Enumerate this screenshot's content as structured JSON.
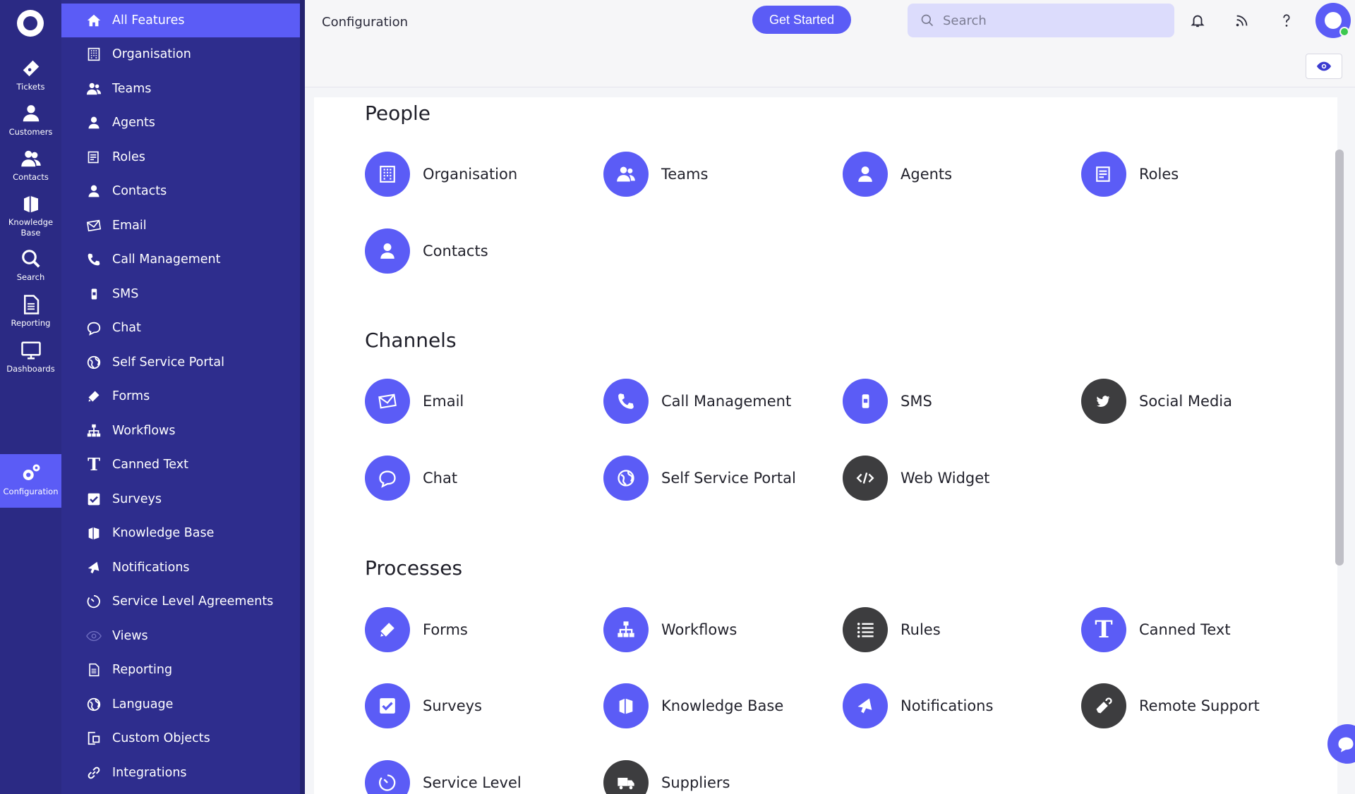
{
  "rail": {
    "items": [
      {
        "label": "Tickets",
        "icon": "ticket-icon"
      },
      {
        "label": "Customers",
        "icon": "customer-icon"
      },
      {
        "label": "Contacts",
        "icon": "contacts-icon"
      },
      {
        "label": "Knowledge Base",
        "icon": "book-icon"
      },
      {
        "label": "Search",
        "icon": "search-icon"
      },
      {
        "label": "Reporting",
        "icon": "report-icon"
      },
      {
        "label": "Dashboards",
        "icon": "monitor-icon"
      },
      {
        "label": "Configuration",
        "icon": "gears-icon"
      }
    ]
  },
  "sidebar": {
    "items": [
      {
        "label": "All Features",
        "icon": "home-icon"
      },
      {
        "label": "Organisation",
        "icon": "building-icon"
      },
      {
        "label": "Teams",
        "icon": "team-icon"
      },
      {
        "label": "Agents",
        "icon": "agent-icon"
      },
      {
        "label": "Roles",
        "icon": "roles-icon"
      },
      {
        "label": "Contacts",
        "icon": "contact-icon"
      },
      {
        "label": "Email",
        "icon": "email-icon"
      },
      {
        "label": "Call Management",
        "icon": "phone-icon"
      },
      {
        "label": "SMS",
        "icon": "mobile-icon"
      },
      {
        "label": "Chat",
        "icon": "chat-icon"
      },
      {
        "label": "Self Service Portal",
        "icon": "globe-icon"
      },
      {
        "label": "Forms",
        "icon": "form-icon"
      },
      {
        "label": "Workflows",
        "icon": "workflow-icon"
      },
      {
        "label": "Canned Text",
        "icon": "text-icon"
      },
      {
        "label": "Surveys",
        "icon": "checkbox-icon"
      },
      {
        "label": "Knowledge Base",
        "icon": "book-icon"
      },
      {
        "label": "Notifications",
        "icon": "megaphone-icon"
      },
      {
        "label": "Service Level Agreements",
        "icon": "timer-icon"
      },
      {
        "label": "Views",
        "icon": "eye-icon"
      },
      {
        "label": "Reporting",
        "icon": "report-icon"
      },
      {
        "label": "Language",
        "icon": "globe-icon"
      },
      {
        "label": "Custom Objects",
        "icon": "object-icon"
      },
      {
        "label": "Integrations",
        "icon": "link-icon"
      }
    ]
  },
  "header": {
    "breadcrumb": "Configuration",
    "get_started": "Get Started",
    "search_placeholder": "Search"
  },
  "sections": {
    "people": {
      "title": "People",
      "tiles": [
        {
          "label": "Organisation",
          "icon": "building-icon"
        },
        {
          "label": "Teams",
          "icon": "team-icon"
        },
        {
          "label": "Agents",
          "icon": "agent-icon"
        },
        {
          "label": "Roles",
          "icon": "roles-icon"
        },
        {
          "label": "Contacts",
          "icon": "contact-icon"
        }
      ]
    },
    "channels": {
      "title": "Channels",
      "tiles": [
        {
          "label": "Email",
          "icon": "email-icon"
        },
        {
          "label": "Call Management",
          "icon": "phone-icon"
        },
        {
          "label": "SMS",
          "icon": "mobile-icon"
        },
        {
          "label": "Social Media",
          "icon": "twitter-icon"
        },
        {
          "label": "Chat",
          "icon": "chat-icon"
        },
        {
          "label": "Self Service Portal",
          "icon": "globe-icon"
        },
        {
          "label": "Web Widget",
          "icon": "code-icon"
        }
      ]
    },
    "processes": {
      "title": "Processes",
      "tiles": [
        {
          "label": "Forms",
          "icon": "form-icon"
        },
        {
          "label": "Workflows",
          "icon": "workflow-icon"
        },
        {
          "label": "Rules",
          "icon": "list-icon"
        },
        {
          "label": "Canned Text",
          "icon": "text-icon"
        },
        {
          "label": "Surveys",
          "icon": "checkbox-icon"
        },
        {
          "label": "Knowledge Base",
          "icon": "book-icon"
        },
        {
          "label": "Notifications",
          "icon": "megaphone-icon"
        },
        {
          "label": "Remote Support",
          "icon": "remote-icon"
        },
        {
          "label": "Service Level",
          "icon": "timer-icon"
        },
        {
          "label": "Suppliers",
          "icon": "truck-icon"
        }
      ]
    }
  },
  "colors": {
    "accent": "#5b5cf6",
    "rail_bg": "#2b2a84",
    "sidebar_bg": "#2e2d8d",
    "dark_tile": "#3d3d3f",
    "online": "#3cc84f"
  }
}
